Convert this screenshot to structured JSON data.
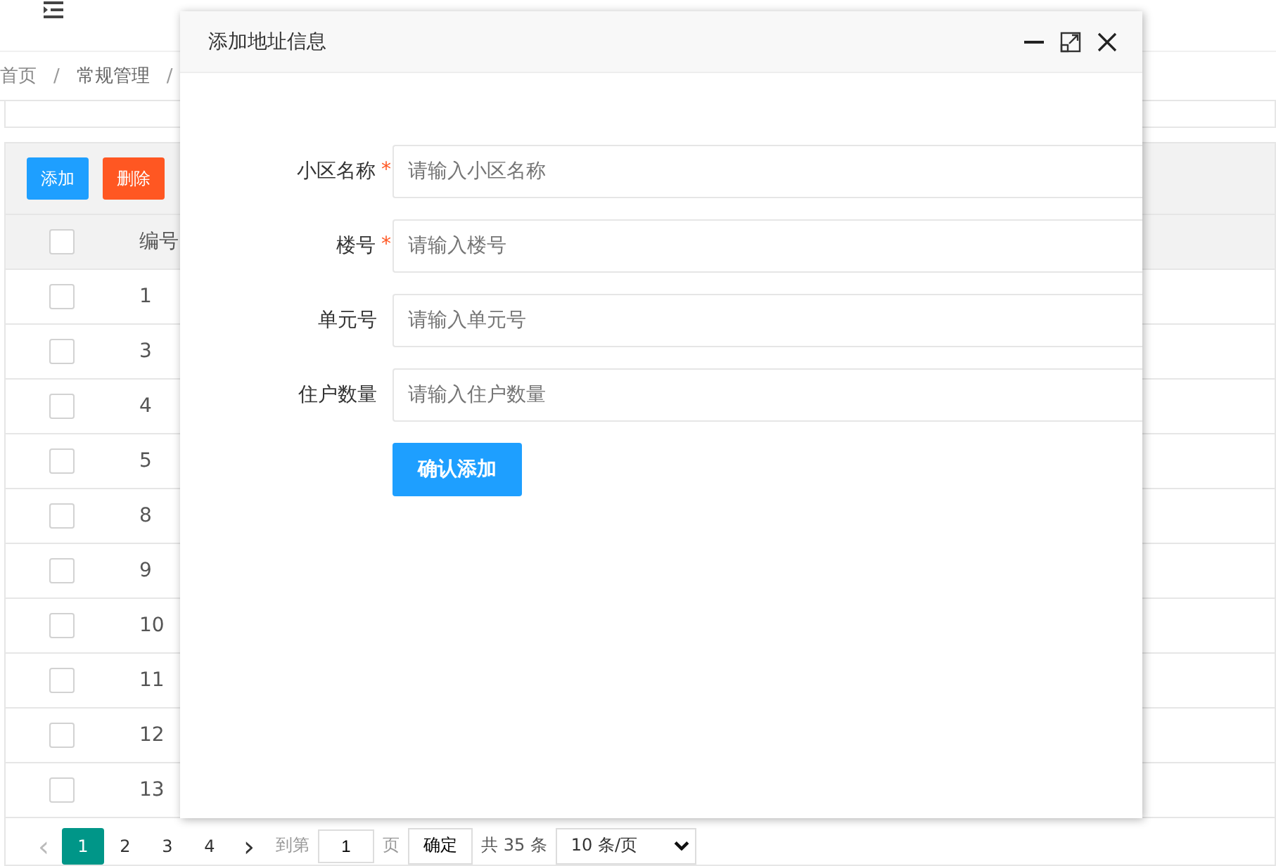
{
  "breadcrumb": [
    {
      "label": "首页",
      "separator": "/"
    },
    {
      "label": "常规管理",
      "separator": "/"
    }
  ],
  "toolbar": {
    "buttons": [
      {
        "label": "添加",
        "kind": "primary"
      },
      {
        "label": "删除",
        "kind": "danger"
      }
    ]
  },
  "table": {
    "columns": [
      "编号"
    ],
    "header_checked": false,
    "rows": [
      {
        "number": "1",
        "checked": false
      },
      {
        "number": "3",
        "checked": false
      },
      {
        "number": "4",
        "checked": false
      },
      {
        "number": "5",
        "checked": false
      },
      {
        "number": "8",
        "checked": false
      },
      {
        "number": "9",
        "checked": false
      },
      {
        "number": "10",
        "checked": false
      },
      {
        "number": "11",
        "checked": false
      },
      {
        "number": "12",
        "checked": false
      },
      {
        "number": "13",
        "checked": false
      }
    ]
  },
  "pagination": {
    "prev": "‹",
    "prev_disabled": true,
    "pages": [
      {
        "label": "1",
        "selected": true
      },
      {
        "label": "2",
        "selected": false
      },
      {
        "label": "3",
        "selected": false
      },
      {
        "label": "4",
        "selected": false
      }
    ],
    "next": "›",
    "goto_prefix": "到第",
    "goto_value": "1",
    "goto_suffix": "页",
    "confirm": "确定",
    "total": "共 35 条",
    "page_size": "10 条/页"
  },
  "dialog": {
    "title": "添加地址信息",
    "fields": [
      {
        "label": "小区名称",
        "required": true,
        "required_mark": "*",
        "placeholder": "请输入小区名称"
      },
      {
        "label": "楼号",
        "required": true,
        "required_mark": "*",
        "placeholder": "请输入楼号"
      },
      {
        "label": "单元号",
        "required": false,
        "placeholder": "请输入单元号"
      },
      {
        "label": "住户数量",
        "required": false,
        "placeholder": "请输入住户数量"
      }
    ],
    "submit": "确认添加"
  }
}
